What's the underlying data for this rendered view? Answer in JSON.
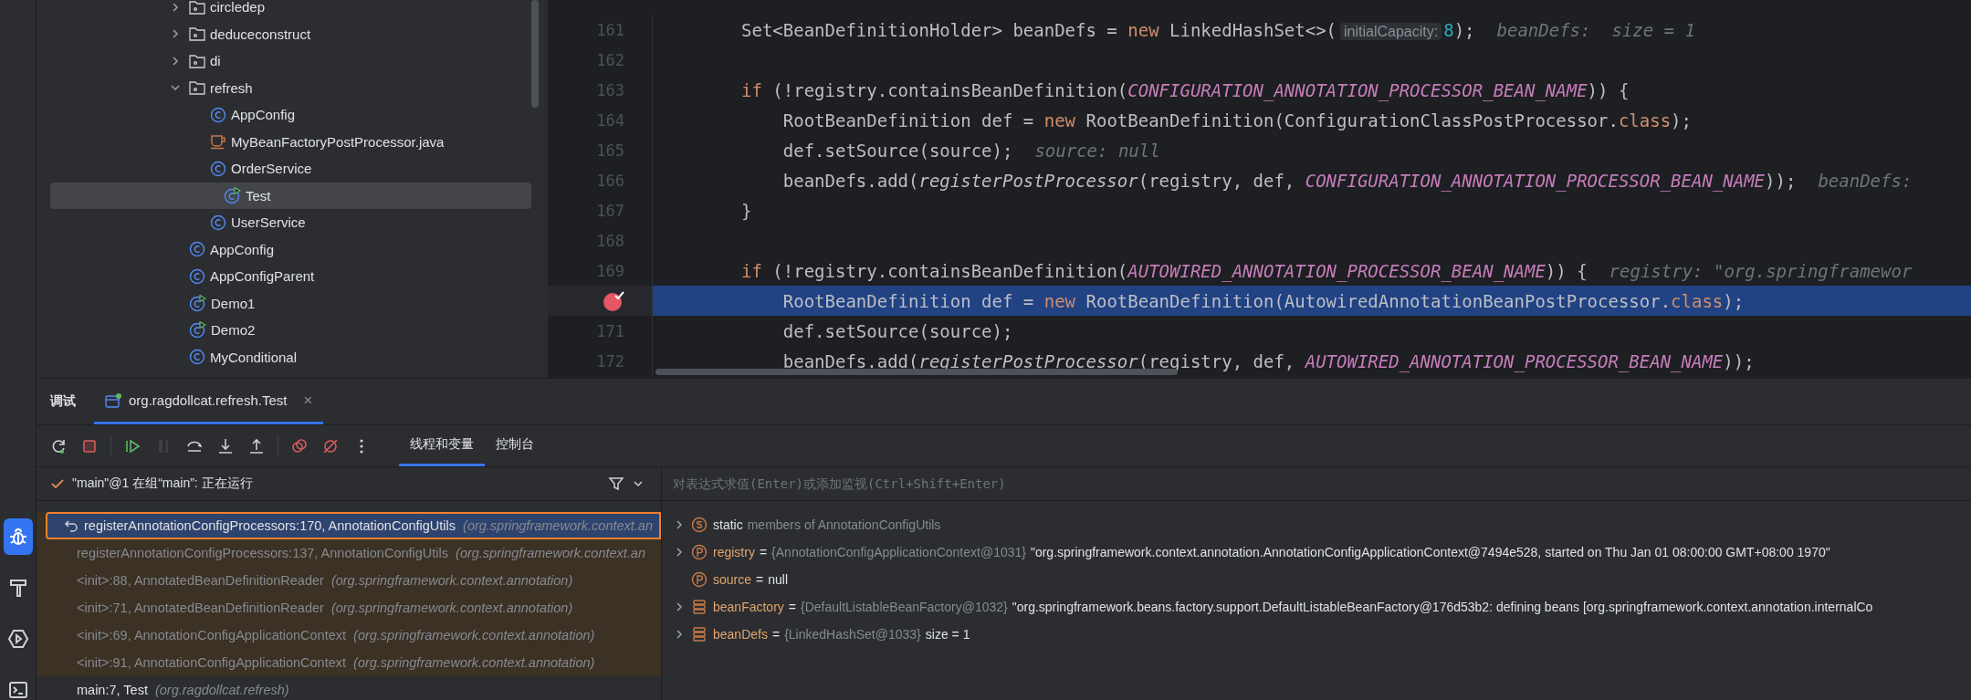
{
  "tool_strip": {
    "items": [
      {
        "kind": "debug",
        "selected": true
      },
      {
        "kind": "build",
        "selected": false
      },
      {
        "kind": "services",
        "selected": false
      },
      {
        "kind": "terminal",
        "selected": false
      }
    ]
  },
  "project_tree": {
    "items": [
      {
        "label": "circledep",
        "kind": "package",
        "expanded": false,
        "selected": false
      },
      {
        "label": "deduceconstruct",
        "kind": "package",
        "expanded": false,
        "selected": false
      },
      {
        "label": "di",
        "kind": "package",
        "expanded": false,
        "selected": false
      },
      {
        "label": "refresh",
        "kind": "package",
        "expanded": true,
        "selected": false,
        "children": [
          {
            "label": "AppConfig",
            "kind": "class",
            "selected": false
          },
          {
            "label": "MyBeanFactoryPostProcessor.java",
            "kind": "java_file",
            "selected": false
          },
          {
            "label": "OrderService",
            "kind": "class",
            "selected": false
          },
          {
            "label": "Test",
            "kind": "main_class",
            "selected": true
          },
          {
            "label": "UserService",
            "kind": "class",
            "selected": false
          }
        ]
      },
      {
        "label": "AppConfig",
        "kind": "class",
        "selected": false
      },
      {
        "label": "AppConfigParent",
        "kind": "class",
        "selected": false
      },
      {
        "label": "Demo1",
        "kind": "main_class",
        "selected": false
      },
      {
        "label": "Demo2",
        "kind": "main_class",
        "selected": false
      },
      {
        "label": "MyConditional",
        "kind": "class",
        "selected": false
      }
    ]
  },
  "editor": {
    "lines": [
      {
        "number": "161",
        "current": false,
        "breakpoint": false,
        "tokens": [
          {
            "kind": "plain",
            "text": "Set<BeanDefinitionHolder> beanDefs = "
          },
          {
            "kind": "keyword",
            "text": "new"
          },
          {
            "kind": "plain",
            "text": " LinkedHashSet<>("
          },
          {
            "kind": "param_hint",
            "text": "initialCapacity:"
          },
          {
            "kind": "number",
            "text": "8"
          },
          {
            "kind": "plain",
            "text": ");"
          },
          {
            "kind": "hint",
            "text": "beanDefs:  size = 1"
          }
        ]
      },
      {
        "number": "162",
        "current": false,
        "breakpoint": false
      },
      {
        "number": "163",
        "current": false,
        "breakpoint": false,
        "tokens": [
          {
            "kind": "keyword",
            "text": "if"
          },
          {
            "kind": "plain",
            "text": " (!registry.containsBeanDefinition("
          },
          {
            "kind": "constant",
            "text": "CONFIGURATION_ANNOTATION_PROCESSOR_BEAN_NAME"
          },
          {
            "kind": "plain",
            "text": ")) {"
          }
        ]
      },
      {
        "number": "164",
        "current": false,
        "breakpoint": false,
        "tokens": [
          {
            "kind": "plain",
            "text": "    RootBeanDefinition def = "
          },
          {
            "kind": "keyword",
            "text": "new"
          },
          {
            "kind": "plain",
            "text": " RootBeanDefinition(ConfigurationClassPostProcessor."
          },
          {
            "kind": "keyword",
            "text": "class"
          },
          {
            "kind": "plain",
            "text": ");"
          }
        ]
      },
      {
        "number": "165",
        "current": false,
        "breakpoint": false,
        "tokens": [
          {
            "kind": "plain",
            "text": "    def.setSource(source);"
          },
          {
            "kind": "hint",
            "text": "source: null"
          }
        ]
      },
      {
        "number": "166",
        "current": false,
        "breakpoint": false,
        "tokens": [
          {
            "kind": "plain",
            "text": "    beanDefs.add("
          },
          {
            "kind": "method",
            "text": "registerPostProcessor"
          },
          {
            "kind": "plain",
            "text": "(registry, def, "
          },
          {
            "kind": "constant",
            "text": "CONFIGURATION_ANNOTATION_PROCESSOR_BEAN_NAME"
          },
          {
            "kind": "plain",
            "text": "));"
          },
          {
            "kind": "hint",
            "text": "beanDefs:"
          }
        ]
      },
      {
        "number": "167",
        "current": false,
        "breakpoint": false,
        "tokens": [
          {
            "kind": "plain",
            "text": "}"
          }
        ]
      },
      {
        "number": "168",
        "current": false,
        "breakpoint": false
      },
      {
        "number": "169",
        "current": false,
        "breakpoint": false,
        "tokens": [
          {
            "kind": "keyword",
            "text": "if"
          },
          {
            "kind": "plain",
            "text": " (!registry.containsBeanDefinition("
          },
          {
            "kind": "constant",
            "text": "AUTOWIRED_ANNOTATION_PROCESSOR_BEAN_NAME"
          },
          {
            "kind": "plain",
            "text": ")) {"
          },
          {
            "kind": "hint",
            "text": "registry: \"org.springframewor"
          }
        ]
      },
      {
        "current": true,
        "breakpoint": true,
        "tokens": [
          {
            "kind": "plain",
            "text": "    RootBeanDefinition def = "
          },
          {
            "kind": "keyword",
            "text": "new"
          },
          {
            "kind": "plain",
            "text": " RootBeanDefinition(AutowiredAnnotationBeanPostProcessor."
          },
          {
            "kind": "keyword",
            "text": "class"
          },
          {
            "kind": "plain",
            "text": ");"
          }
        ]
      },
      {
        "number": "171",
        "current": false,
        "breakpoint": false,
        "tokens": [
          {
            "kind": "plain",
            "text": "    def.setSource(source);"
          }
        ]
      },
      {
        "number": "172",
        "current": false,
        "breakpoint": false,
        "tokens": [
          {
            "kind": "plain",
            "text": "    beanDefs.add("
          },
          {
            "kind": "method",
            "text": "registerPostProcessor"
          },
          {
            "kind": "plain",
            "text": "(registry, def, "
          },
          {
            "kind": "constant",
            "text": "AUTOWIRED_ANNOTATION_PROCESSOR_BEAN_NAME"
          },
          {
            "kind": "plain",
            "text": "));"
          }
        ]
      }
    ]
  },
  "debug": {
    "title": "调试",
    "tabs": [
      {
        "label": "org.ragdollcat.refresh.Test",
        "close": "×",
        "selected": true
      }
    ],
    "toolbar": [
      {
        "kind": "rerun",
        "disabled": false
      },
      {
        "kind": "stop",
        "disabled": false
      },
      {
        "kind": "resume",
        "disabled": false
      },
      {
        "kind": "pause",
        "disabled": true
      },
      {
        "kind": "step_over",
        "disabled": false
      },
      {
        "kind": "step_into",
        "disabled": false
      },
      {
        "kind": "step_out",
        "disabled": false
      },
      {
        "kind": "breakpoints",
        "disabled": false
      },
      {
        "kind": "mute",
        "disabled": false
      },
      {
        "kind": "more",
        "disabled": false
      }
    ],
    "view_tabs": [
      {
        "label": "线程和变量",
        "selected": true
      },
      {
        "label": "控制台",
        "selected": false
      }
    ],
    "thread": {
      "label": "\"main\"@1 在组“main”: 正在运行"
    },
    "evaluate": {
      "placeholder": "对表达式求值(Enter)或添加监视(Ctrl+Shift+Enter)"
    },
    "frames": [
      {
        "method": "registerAnnotationConfigProcessors:170, AnnotationConfigUtils",
        "package": "(org.springframework.context.an",
        "library": true,
        "selected": true
      },
      {
        "method": "registerAnnotationConfigProcessors:137, AnnotationConfigUtils",
        "package": "(org.springframework.context.an",
        "library": true,
        "selected": false
      },
      {
        "method": "<init>:88, AnnotatedBeanDefinitionReader",
        "package": "(org.springframework.context.annotation)",
        "library": true,
        "selected": false
      },
      {
        "method": "<init>:71, AnnotatedBeanDefinitionReader",
        "package": "(org.springframework.context.annotation)",
        "library": true,
        "selected": false
      },
      {
        "method": "<init>:69, AnnotationConfigApplicationContext",
        "package": "(org.springframework.context.annotation)",
        "library": true,
        "selected": false
      },
      {
        "method": "<init>:91, AnnotationConfigApplicationContext",
        "package": "(org.springframework.context.annotation)",
        "library": true,
        "selected": false
      },
      {
        "method": "main:7, Test",
        "package": "(org.ragdollcat.refresh)",
        "library": false,
        "selected": false
      }
    ],
    "variables": [
      {
        "kind": "static",
        "expandable": true,
        "name": "static",
        "value": "members of AnnotationConfigUtils"
      },
      {
        "kind": "parameter",
        "expandable": true,
        "name": "registry",
        "separator": "=",
        "type": "{AnnotationConfigApplicationContext@1031}",
        "value": "\"org.springframework.context.annotation.AnnotationConfigApplicationContext@7494e528, started on Thu Jan 01 08:00:00 GMT+08:00 1970\""
      },
      {
        "kind": "parameter",
        "expandable": false,
        "name": "source",
        "separator": "=",
        "value": "null"
      },
      {
        "kind": "local",
        "expandable": true,
        "name": "beanFactory",
        "separator": "=",
        "type": "{DefaultListableBeanFactory@1032}",
        "value": "\"org.springframework.beans.factory.support.DefaultListableBeanFactory@176d53b2: defining beans [org.springframework.context.annotation.internalCo"
      },
      {
        "kind": "local",
        "expandable": true,
        "name": "beanDefs",
        "separator": "=",
        "type": "{LinkedHashSet@1033}",
        "value": "size = 1"
      }
    ]
  }
}
